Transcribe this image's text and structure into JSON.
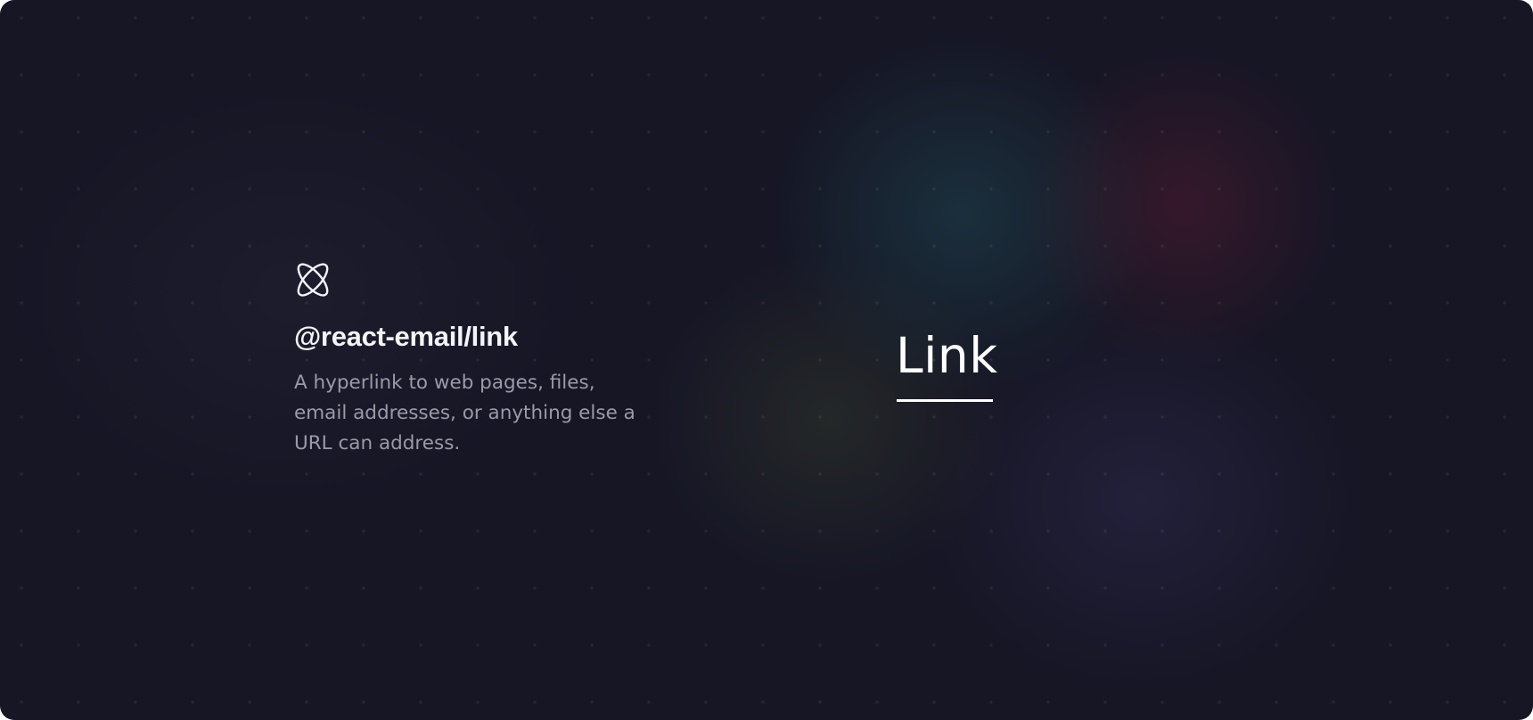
{
  "hero": {
    "icon": "react-atom-icon",
    "title": "@react-email/link",
    "description": "A hyperlink to web pages, files, email addresses, or anything else a URL can address."
  },
  "demo": {
    "link_text": "Link"
  },
  "colors": {
    "background": "#161625",
    "title": "#f4f4f7",
    "description": "#9a9aa8",
    "link": "#ffffff"
  }
}
